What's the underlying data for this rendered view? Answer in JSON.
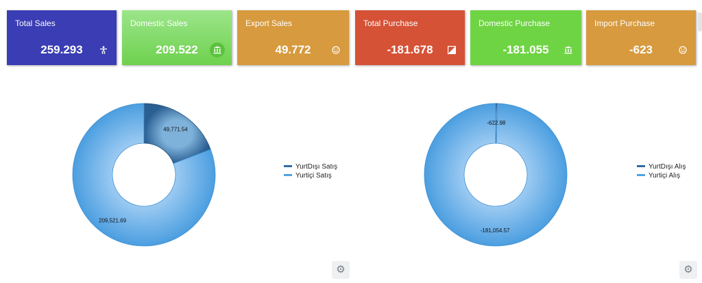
{
  "cards": [
    {
      "title": "Total Sales",
      "value": "259.293",
      "icon": "accessibility-icon",
      "color": "#3a3db3"
    },
    {
      "title": "Domestic Sales",
      "value": "209.522",
      "icon": "bank-icon",
      "color": "#7edb5f"
    },
    {
      "title": "Export Sales",
      "value": "49.772",
      "icon": "smiley-icon",
      "color": "#d79a3e"
    },
    {
      "title": "Total Purchase",
      "value": "-181.678",
      "icon": "chart-icon",
      "color": "#d55236"
    },
    {
      "title": "Domestic Purchase",
      "value": "-181.055",
      "icon": "bank-icon",
      "color": "#6fd444"
    },
    {
      "title": "Import Purchase",
      "value": "-623",
      "icon": "smiley-icon",
      "color": "#d79a3e"
    }
  ],
  "chart_data": [
    {
      "type": "pie",
      "donut": true,
      "categories": [
        "YurtDışı Satış",
        "Yurtiçi Satış"
      ],
      "values": [
        49771.54,
        209521.69
      ],
      "labels": [
        "49,771.54",
        "209,521.69"
      ],
      "colors": [
        "#2f6aa3",
        "#4ea3e4"
      ],
      "legend": "right"
    },
    {
      "type": "pie",
      "donut": true,
      "categories": [
        "YurtDışı Alış",
        "Yurtiçi Alış"
      ],
      "values": [
        -622.98,
        -181054.57
      ],
      "labels": [
        "-622.98",
        "-181,054.57"
      ],
      "colors": [
        "#2f6aa3",
        "#4ea3e4"
      ],
      "legend": "right"
    }
  ],
  "settings_icon": "gear-icon"
}
